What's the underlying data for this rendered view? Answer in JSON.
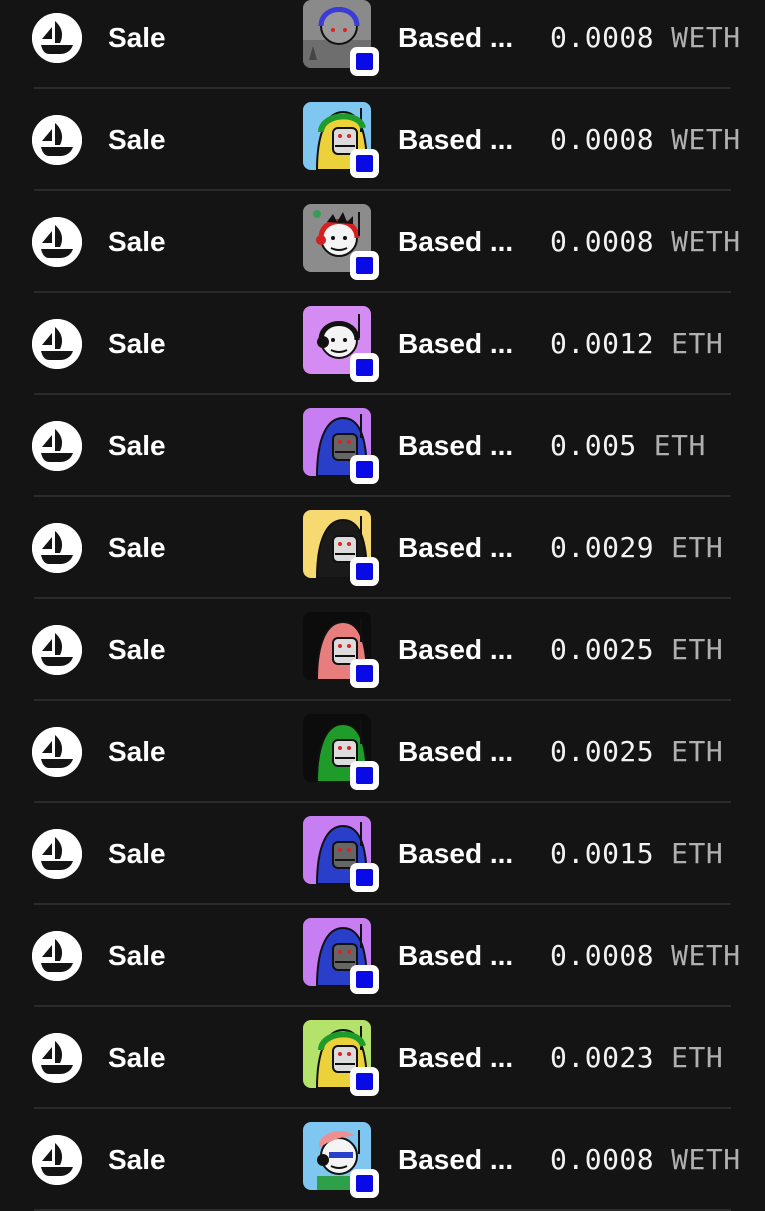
{
  "events": [
    {
      "type": "Sale",
      "item_name": "Based ...",
      "amount": "0.0008",
      "currency": "WETH",
      "thumb_bg": "#8a8a8a",
      "figure": "gray-ghost-blue-headphones"
    },
    {
      "type": "Sale",
      "item_name": "Based ...",
      "amount": "0.0008",
      "currency": "WETH",
      "thumb_bg": "#7fc6f0",
      "figure": "yellow-hood-green-headphones"
    },
    {
      "type": "Sale",
      "item_name": "Based ...",
      "amount": "0.0008",
      "currency": "WETH",
      "thumb_bg": "#8c8c8c",
      "figure": "white-face-red-headphones"
    },
    {
      "type": "Sale",
      "item_name": "Based ...",
      "amount": "0.0012",
      "currency": "ETH",
      "thumb_bg": "#d58cf2",
      "figure": "white-face-black-headphones"
    },
    {
      "type": "Sale",
      "item_name": "Based ...",
      "amount": "0.005",
      "currency": "ETH",
      "thumb_bg": "#c77ef2",
      "figure": "blue-hood"
    },
    {
      "type": "Sale",
      "item_name": "Based ...",
      "amount": "0.0029",
      "currency": "ETH",
      "thumb_bg": "#f6d970",
      "figure": "black-hood"
    },
    {
      "type": "Sale",
      "item_name": "Based ...",
      "amount": "0.0025",
      "currency": "ETH",
      "thumb_bg": "#0c0c0c",
      "figure": "pink-hood"
    },
    {
      "type": "Sale",
      "item_name": "Based ...",
      "amount": "0.0025",
      "currency": "ETH",
      "thumb_bg": "#0c0c0c",
      "figure": "green-hood"
    },
    {
      "type": "Sale",
      "item_name": "Based ...",
      "amount": "0.0015",
      "currency": "ETH",
      "thumb_bg": "#c77ef2",
      "figure": "blue-hood"
    },
    {
      "type": "Sale",
      "item_name": "Based ...",
      "amount": "0.0008",
      "currency": "WETH",
      "thumb_bg": "#c77ef2",
      "figure": "blue-hood"
    },
    {
      "type": "Sale",
      "item_name": "Based ...",
      "amount": "0.0023",
      "currency": "ETH",
      "thumb_bg": "#b4e26a",
      "figure": "yellow-hood-green-cap"
    },
    {
      "type": "Sale",
      "item_name": "Based ...",
      "amount": "0.0008",
      "currency": "WETH",
      "thumb_bg": "#7fc6f0",
      "figure": "white-face-pink-hair"
    }
  ],
  "icons": {
    "marketplace": "opensea-ship-icon",
    "chain_badge": "chain-badge-icon"
  },
  "colors": {
    "background": "#141414",
    "divider": "#2b2b2b",
    "badge": "#0a0ae6"
  }
}
